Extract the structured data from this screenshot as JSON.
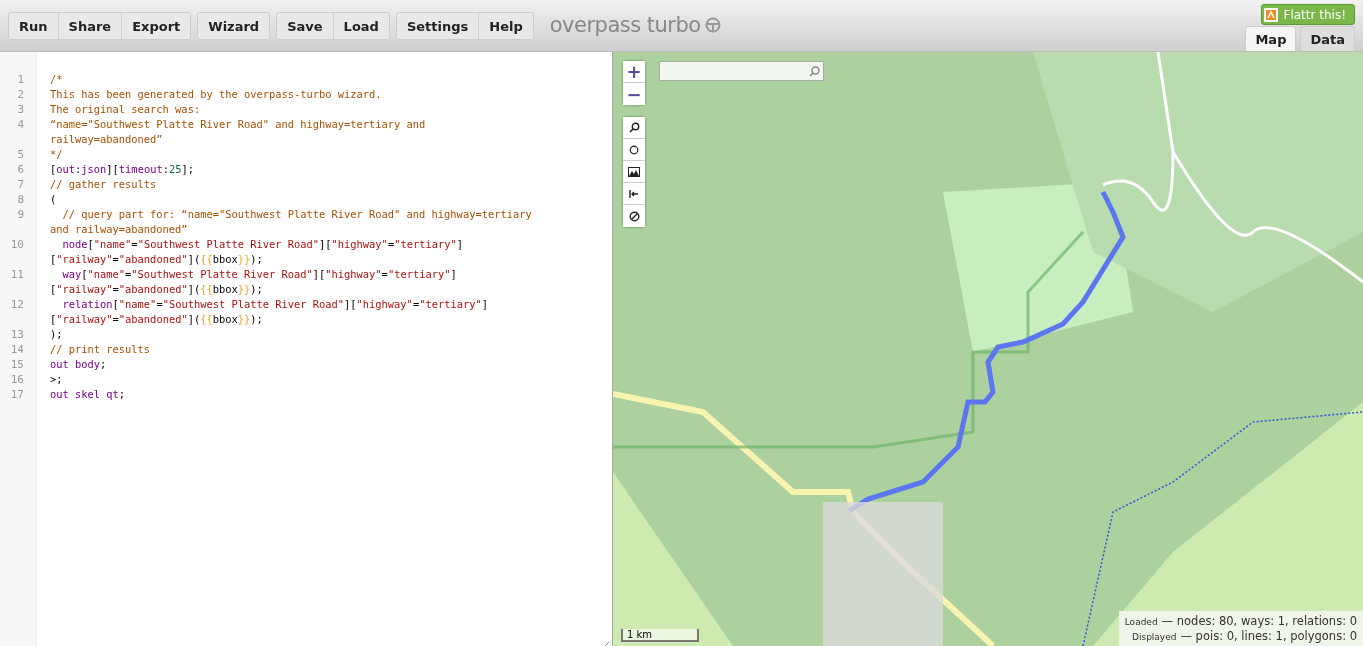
{
  "toolbar": {
    "groups": [
      [
        "Run",
        "Share",
        "Export"
      ],
      [
        "Wizard"
      ],
      [
        "Save",
        "Load"
      ],
      [
        "Settings",
        "Help"
      ]
    ],
    "logo": "overpass turbo",
    "flattr": "Flattr this!"
  },
  "tabs": [
    {
      "label": "Map",
      "selected": true
    },
    {
      "label": "Data",
      "selected": false
    }
  ],
  "editor": {
    "lines": [
      {
        "number": "1",
        "rows": [
          {
            "tokens": [
              {
                "kind": "comment",
                "text": "/*"
              }
            ]
          }
        ]
      },
      {
        "number": "2",
        "rows": [
          {
            "tokens": [
              {
                "kind": "comment",
                "text": "This has been generated by the overpass-turbo wizard."
              }
            ]
          }
        ]
      },
      {
        "number": "3",
        "rows": [
          {
            "tokens": [
              {
                "kind": "comment",
                "text": "The original search was:"
              }
            ]
          }
        ]
      },
      {
        "number": "4",
        "rows": [
          {
            "tokens": [
              {
                "kind": "comment",
                "text": "“name=\"Southwest Platte River Road\" and highway=tertiary and"
              }
            ]
          },
          {
            "tokens": [
              {
                "kind": "comment",
                "text": "railway=abandoned”"
              }
            ]
          }
        ]
      },
      {
        "number": "5",
        "rows": [
          {
            "tokens": [
              {
                "kind": "comment",
                "text": "*/"
              }
            ]
          }
        ]
      },
      {
        "number": "6",
        "rows": [
          {
            "tokens": [
              {
                "kind": "plain",
                "text": "["
              },
              {
                "kind": "keyword",
                "text": "out"
              },
              {
                "kind": "plain",
                "text": ":"
              },
              {
                "kind": "keyword",
                "text": "json"
              },
              {
                "kind": "plain",
                "text": "]["
              },
              {
                "kind": "keyword",
                "text": "timeout"
              },
              {
                "kind": "plain",
                "text": ":"
              },
              {
                "kind": "number",
                "text": "25"
              },
              {
                "kind": "plain",
                "text": "];"
              }
            ]
          }
        ]
      },
      {
        "number": "7",
        "rows": [
          {
            "tokens": [
              {
                "kind": "comment",
                "text": "// gather results"
              }
            ]
          }
        ]
      },
      {
        "number": "8",
        "rows": [
          {
            "tokens": [
              {
                "kind": "plain",
                "text": "("
              }
            ]
          }
        ]
      },
      {
        "number": "9",
        "rows": [
          {
            "tokens": [
              {
                "kind": "comment",
                "text": "  // query part for: “name=\"Southwest Platte River Road\" and highway=tertiary"
              }
            ]
          },
          {
            "tokens": [
              {
                "kind": "comment",
                "text": "and railway=abandoned”"
              }
            ]
          }
        ]
      },
      {
        "number": "10",
        "rows": [
          {
            "tokens": [
              {
                "kind": "keyword",
                "text": "  node"
              },
              {
                "kind": "plain",
                "text": "["
              },
              {
                "kind": "string",
                "text": "\"name\""
              },
              {
                "kind": "plain",
                "text": "="
              },
              {
                "kind": "string",
                "text": "\"Southwest Platte River Road\""
              },
              {
                "kind": "plain",
                "text": "]["
              },
              {
                "kind": "string",
                "text": "\"highway\""
              },
              {
                "kind": "plain",
                "text": "="
              },
              {
                "kind": "string",
                "text": "\"tertiary\""
              },
              {
                "kind": "plain",
                "text": "]"
              }
            ]
          },
          {
            "tokens": [
              {
                "kind": "plain",
                "text": "["
              },
              {
                "kind": "string",
                "text": "\"railway\""
              },
              {
                "kind": "plain",
                "text": "="
              },
              {
                "kind": "string",
                "text": "\"abandoned\""
              },
              {
                "kind": "plain",
                "text": "]("
              },
              {
                "kind": "brace",
                "text": "{{"
              },
              {
                "kind": "plain",
                "text": "bbox"
              },
              {
                "kind": "brace",
                "text": "}}"
              },
              {
                "kind": "plain",
                "text": ");"
              }
            ]
          }
        ]
      },
      {
        "number": "11",
        "rows": [
          {
            "tokens": [
              {
                "kind": "keyword",
                "text": "  way"
              },
              {
                "kind": "plain",
                "text": "["
              },
              {
                "kind": "string",
                "text": "\"name\""
              },
              {
                "kind": "plain",
                "text": "="
              },
              {
                "kind": "string",
                "text": "\"Southwest Platte River Road\""
              },
              {
                "kind": "plain",
                "text": "]["
              },
              {
                "kind": "string",
                "text": "\"highway\""
              },
              {
                "kind": "plain",
                "text": "="
              },
              {
                "kind": "string",
                "text": "\"tertiary\""
              },
              {
                "kind": "plain",
                "text": "]"
              }
            ]
          },
          {
            "tokens": [
              {
                "kind": "plain",
                "text": "["
              },
              {
                "kind": "string",
                "text": "\"railway\""
              },
              {
                "kind": "plain",
                "text": "="
              },
              {
                "kind": "string",
                "text": "\"abandoned\""
              },
              {
                "kind": "plain",
                "text": "]("
              },
              {
                "kind": "brace",
                "text": "{{"
              },
              {
                "kind": "plain",
                "text": "bbox"
              },
              {
                "kind": "brace",
                "text": "}}"
              },
              {
                "kind": "plain",
                "text": ");"
              }
            ]
          }
        ]
      },
      {
        "number": "12",
        "rows": [
          {
            "tokens": [
              {
                "kind": "keyword",
                "text": "  relation"
              },
              {
                "kind": "plain",
                "text": "["
              },
              {
                "kind": "string",
                "text": "\"name\""
              },
              {
                "kind": "plain",
                "text": "="
              },
              {
                "kind": "string",
                "text": "\"Southwest Platte River Road\""
              },
              {
                "kind": "plain",
                "text": "]["
              },
              {
                "kind": "string",
                "text": "\"highway\""
              },
              {
                "kind": "plain",
                "text": "="
              },
              {
                "kind": "string",
                "text": "\"tertiary\""
              },
              {
                "kind": "plain",
                "text": "]"
              }
            ]
          },
          {
            "tokens": [
              {
                "kind": "plain",
                "text": "["
              },
              {
                "kind": "string",
                "text": "\"railway\""
              },
              {
                "kind": "plain",
                "text": "="
              },
              {
                "kind": "string",
                "text": "\"abandoned\""
              },
              {
                "kind": "plain",
                "text": "]("
              },
              {
                "kind": "brace",
                "text": "{{"
              },
              {
                "kind": "plain",
                "text": "bbox"
              },
              {
                "kind": "brace",
                "text": "}}"
              },
              {
                "kind": "plain",
                "text": ");"
              }
            ]
          }
        ]
      },
      {
        "number": "13",
        "rows": [
          {
            "tokens": [
              {
                "kind": "plain",
                "text": ");"
              }
            ]
          }
        ]
      },
      {
        "number": "14",
        "rows": [
          {
            "tokens": [
              {
                "kind": "comment",
                "text": "// print results"
              }
            ]
          }
        ]
      },
      {
        "number": "15",
        "rows": [
          {
            "tokens": [
              {
                "kind": "keyword",
                "text": "out body"
              },
              {
                "kind": "plain",
                "text": ";"
              }
            ]
          }
        ]
      },
      {
        "number": "16",
        "rows": [
          {
            "tokens": [
              {
                "kind": "plain",
                "text": ">;"
              }
            ]
          }
        ]
      },
      {
        "number": "17",
        "rows": [
          {
            "tokens": [
              {
                "kind": "keyword",
                "text": "out skel qt"
              },
              {
                "kind": "plain",
                "text": ";"
              }
            ]
          }
        ]
      }
    ]
  },
  "map": {
    "zoom_in": "+",
    "zoom_out": "−",
    "scale": "1 km",
    "stats": [
      {
        "label": "Loaded",
        "text": "— nodes: 80, ways: 1, relations: 0"
      },
      {
        "label": "Displayed",
        "text": "— pois: 0, lines: 1, polygons: 0"
      }
    ]
  }
}
